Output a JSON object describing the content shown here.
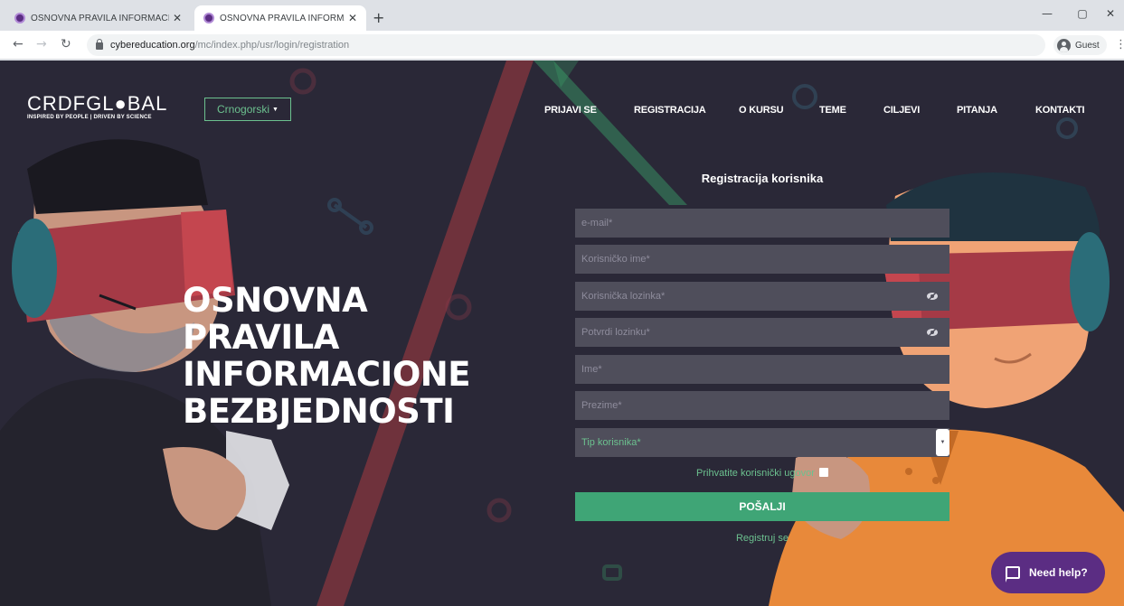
{
  "browser": {
    "tabs": [
      {
        "title": "OSNOVNA PRAVILA INFORMACI",
        "active": false
      },
      {
        "title": "OSNOVNA PRAVILA INFORMACI",
        "active": true
      }
    ],
    "url_host": "cybereducation.org",
    "url_path": "/mc/index.php/usr/login/registration",
    "profile_label": "Guest"
  },
  "header": {
    "logo_name": "CRDFGL●BAL",
    "logo_tagline": "INSPIRED BY PEOPLE | DRIVEN BY SCIENCE",
    "language": "Crnogorski",
    "nav": [
      "PRIJAVI SE",
      "REGISTRACIJA",
      "O KURSU",
      "TEME",
      "CILJEVI",
      "PITANJA",
      "KONTAKTI"
    ]
  },
  "hero": {
    "lines": [
      "OSNOVNA",
      "PRAVILA",
      "INFORMACIONE",
      "BEZBJEDNOSTI"
    ]
  },
  "form": {
    "title": "Registracija korisnika",
    "email_placeholder": "e-mail*",
    "username_placeholder": "Korisničko ime*",
    "password_placeholder": "Korisnička lozinka*",
    "confirm_placeholder": "Potvrdi lozinku*",
    "firstname_placeholder": "Ime*",
    "lastname_placeholder": "Prezime*",
    "user_type": "Tip korisnika*",
    "terms_label": "Prihvatite korisnički ugovor",
    "submit_label": "POŠALJI",
    "register_link": "Registruj se"
  },
  "help_widget": {
    "label": "Need help?"
  },
  "colors": {
    "accent_green": "#3fa576",
    "link_green": "#6cc18f",
    "page_bg": "#2a2837",
    "field_bg": "#4f4e5b",
    "brand_purple": "#5b2d83"
  },
  "icons": [
    "browser-favicon",
    "lock-icon",
    "eye-slash-icon",
    "chat-bubble-icon",
    "chevron-down-icon"
  ]
}
